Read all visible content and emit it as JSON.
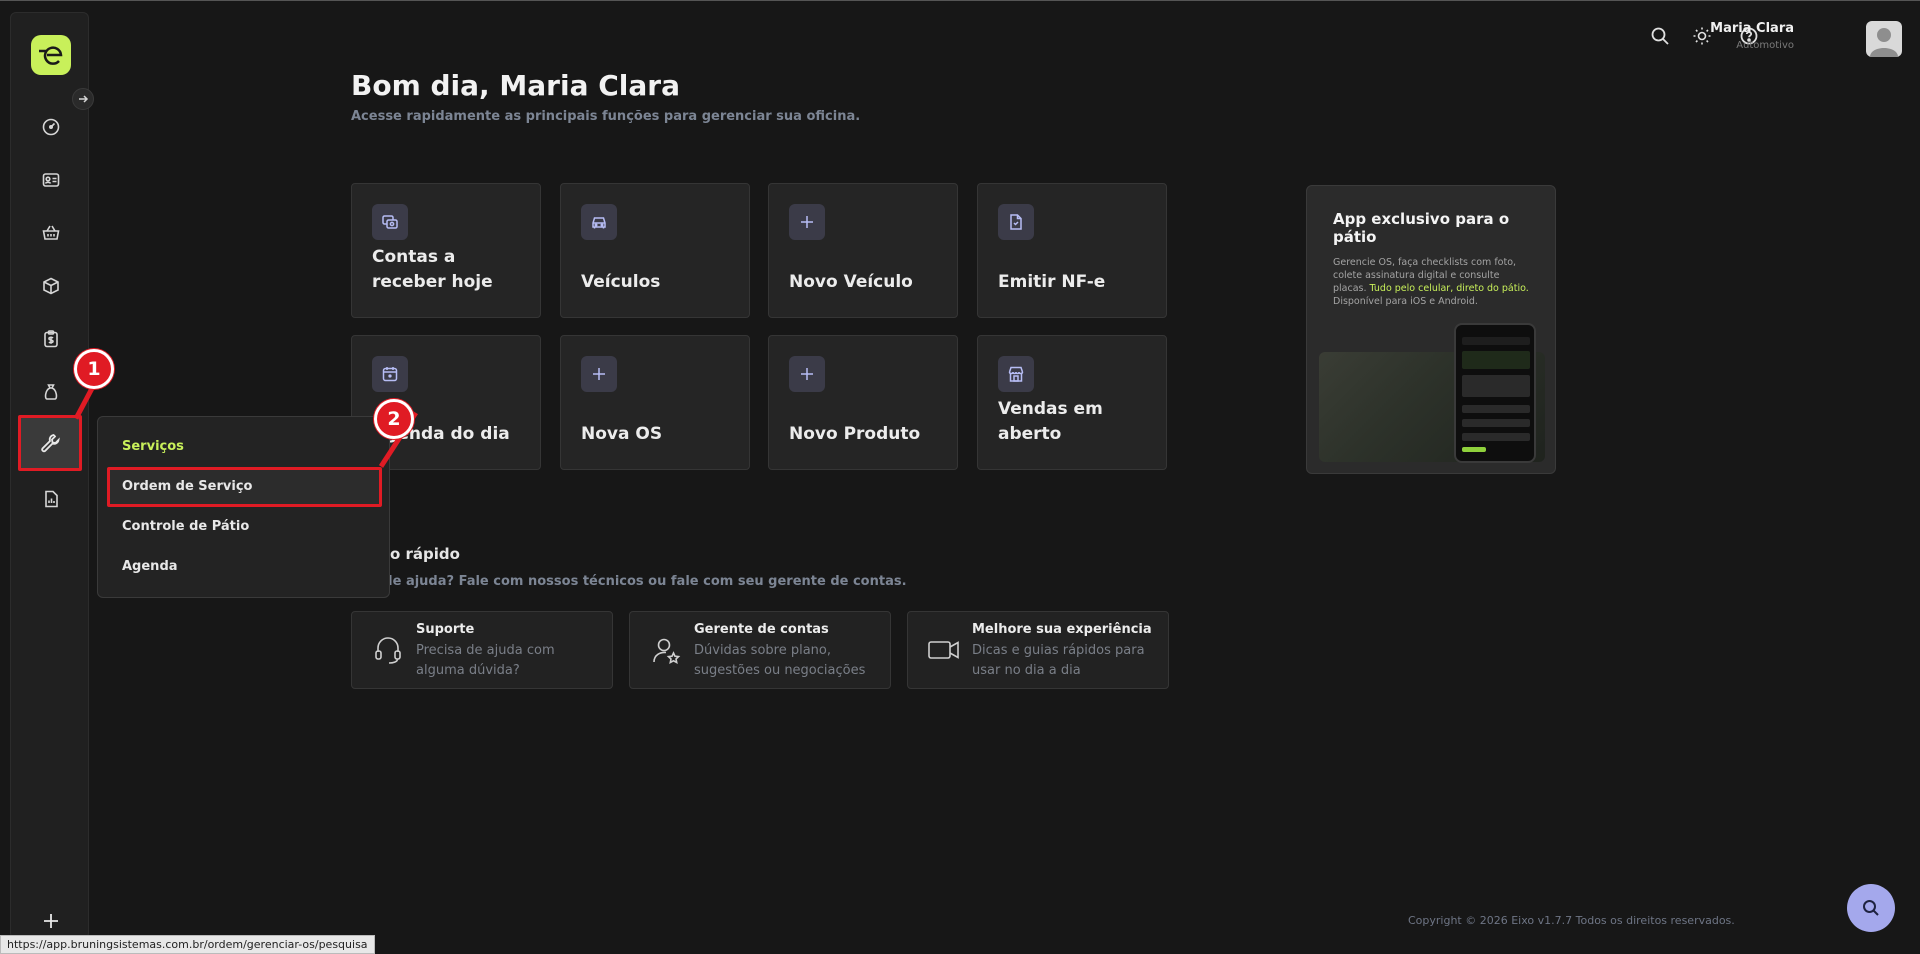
{
  "user": {
    "name": "Maria Clara",
    "role": "Automotivo"
  },
  "greeting": {
    "title": "Bom dia, Maria Clara",
    "subtitle": "Acesse rapidamente as principais funções para gerenciar sua oficina."
  },
  "cards": [
    {
      "label": "Contas a receber hoje",
      "icon": "money-receipt-icon"
    },
    {
      "label": "Veículos",
      "icon": "car-icon"
    },
    {
      "label": "Novo Veículo",
      "icon": "plus-icon"
    },
    {
      "label": "Emitir NF-e",
      "icon": "document-icon"
    },
    {
      "label": "Agenda do dia",
      "icon": "calendar-icon"
    },
    {
      "label": "Nova OS",
      "icon": "plus-icon"
    },
    {
      "label": "Novo Produto",
      "icon": "plus-icon"
    },
    {
      "label": "Vendas em aberto",
      "icon": "store-icon"
    }
  ],
  "promo": {
    "title": "App exclusivo para o pátio",
    "desc_start": "Gerencie OS, faça checklists com foto, colete assinatura digital e consulte placas. ",
    "desc_highlight": "Tudo pelo celular, direto do pátio.",
    "desc_end": " Disponível para iOS e Android."
  },
  "quick_help": {
    "title": "o rápido",
    "subtitle": "a de ajuda? Fale com nossos técnicos ou fale com seu gerente de contas.",
    "items": [
      {
        "title": "Suporte",
        "desc": "Precisa de ajuda com alguma dúvida?",
        "icon": "headset-icon"
      },
      {
        "title": "Gerente de contas",
        "desc": "Dúvidas sobre plano, sugestões ou negociações",
        "icon": "user-star-icon"
      },
      {
        "title": "Melhore sua experiência",
        "desc": "Dicas e guias rápidos para usar no dia a dia",
        "icon": "video-icon"
      }
    ]
  },
  "submenu": {
    "title": "Serviços",
    "items": [
      "Ordem de Serviço",
      "Controle de Pátio",
      "Agenda"
    ]
  },
  "markers": [
    "1",
    "2"
  ],
  "footer": "Copyright © 2026 Eixo v1.7.7 Todos os direitos reservados.",
  "status_url": "https://app.bruningsistemas.com.br/ordem/gerenciar-os/pesquisa",
  "colors": {
    "accent": "#c8f05a",
    "annotation": "#e01b24",
    "fab": "#a4a8ec"
  }
}
